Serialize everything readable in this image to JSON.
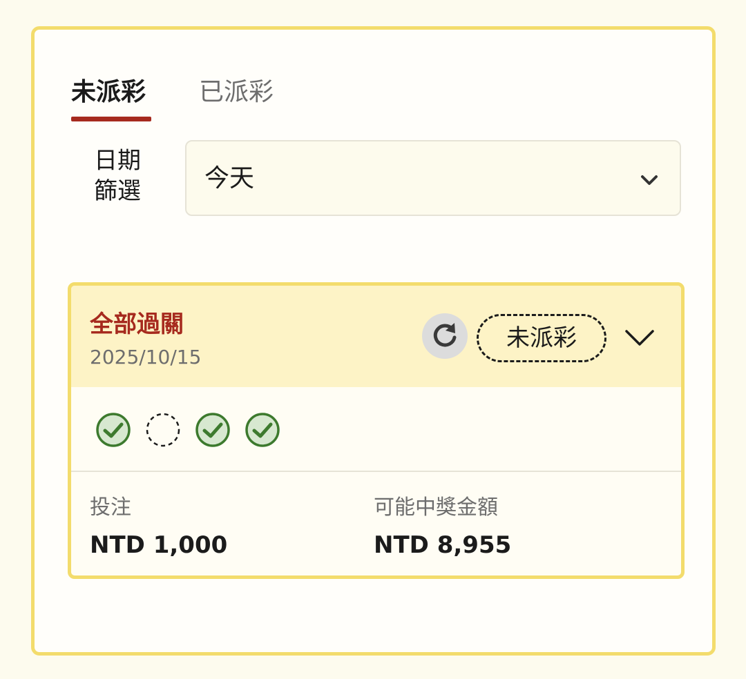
{
  "tabs": [
    {
      "label": "未派彩",
      "active": true
    },
    {
      "label": "已派彩",
      "active": false
    }
  ],
  "date_filter": {
    "label_line1": "日期",
    "label_line2": "篩選",
    "selected": "今天",
    "icon": "chevron-down-icon"
  },
  "bet": {
    "type": "全部過關",
    "date": "2025/10/15",
    "status": "未派彩",
    "refresh_icon": "refresh-icon",
    "expand_icon": "chevron-down-icon",
    "legs": [
      "won",
      "pending",
      "won",
      "won"
    ],
    "stake_label": "投注",
    "stake_value": "NTD 1,000",
    "potential_label": "可能中獎金額",
    "potential_value": "NTD 8,955"
  },
  "colors": {
    "accent": "#a62a1e",
    "border": "#f3dc6c",
    "header_bg": "#fdf3c6",
    "check_green": "#3d7a2e"
  }
}
